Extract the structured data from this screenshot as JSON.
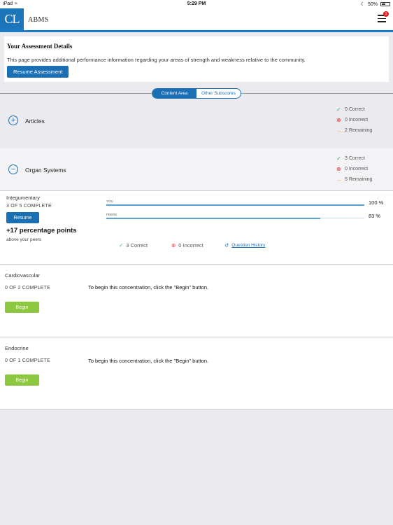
{
  "status_bar": {
    "device": "iPad",
    "time": "5:29 PM",
    "battery": "50%"
  },
  "header": {
    "logo_text": "CL",
    "app_name": "ABMS",
    "notification_count": "1"
  },
  "details": {
    "title": "Your Assessment Details",
    "description": "This page provides additional performance information regarding your areas of strength and weakness relative to the community.",
    "resume_label": "Resume Assessment"
  },
  "toggle": {
    "options": [
      "Content Area",
      "Other Subscores"
    ],
    "selected": "Content Area"
  },
  "groups": [
    {
      "name": "Articles",
      "state": "collapsed",
      "correct": "0 Correct",
      "incorrect": "0 Incorrect",
      "remaining": "2 Remaining"
    },
    {
      "name": "Organ Systems",
      "state": "expanded",
      "correct": "3 Correct",
      "incorrect": "0 Incorrect",
      "remaining": "5 Remaining"
    }
  ],
  "subtopics": [
    {
      "name": "Integumentary",
      "complete": "3 OF 5 COMPLETE",
      "action": "Resume",
      "points": "+17 percentage points",
      "points_sub": "above your peers",
      "you_label": "YOU",
      "you_value": "100 %",
      "you_fraction": 1.0,
      "peers_label": "PEERS",
      "peers_value": "83 %",
      "peers_fraction": 0.83,
      "correct": "3 Correct",
      "incorrect": "0 Incorrect",
      "history_link": "Question History"
    },
    {
      "name": "Cardiovascular",
      "complete": "0 OF 2 COMPLETE",
      "message": "To begin this concentration, click the \"Begin\" button.",
      "action": "Begin"
    },
    {
      "name": "Endocrine",
      "complete": "0 OF 1 COMPLETE",
      "message": "To begin this concentration, click the \"Begin\" button.",
      "action": "Begin"
    }
  ],
  "colors": {
    "primary": "#1a6fb5",
    "begin": "#8dc63f",
    "correct": "#3aa655",
    "incorrect": "#dd3333",
    "remaining": "#f0a030"
  }
}
